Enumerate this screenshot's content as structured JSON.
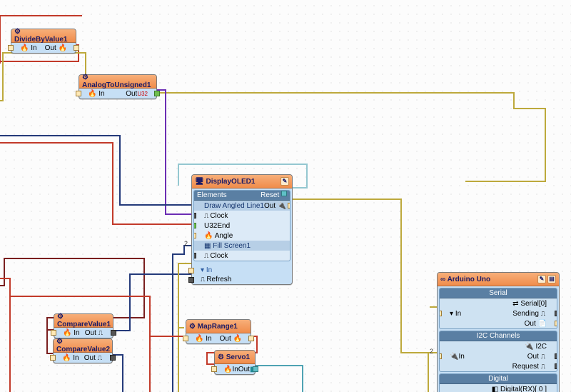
{
  "badges": {
    "two": "2"
  },
  "nodes": {
    "divide": {
      "title": "DivideByValue1",
      "in": "In",
      "out": "Out"
    },
    "atu": {
      "title": "AnalogToUnsigned1",
      "in": "In",
      "out": "Out",
      "out_type": "U32"
    },
    "oled": {
      "title": "DisplayOLED1",
      "sec_elements": "Elements",
      "reset": "Reset",
      "el_line": "Draw Angled Line1",
      "out": "Out",
      "clock": "Clock",
      "end": "End",
      "end_type": "U32",
      "angle": "Angle",
      "el_fill": "Fill Screen1",
      "in": "In",
      "refresh": "Refresh"
    },
    "cmp1": {
      "title": "CompareValue1",
      "in": "In",
      "out": "Out"
    },
    "cmp2": {
      "title": "CompareValue2",
      "in": "In",
      "out": "Out"
    },
    "map": {
      "title": "MapRange1",
      "in": "In",
      "out": "Out"
    },
    "servo": {
      "title": "Servo1",
      "in": "In",
      "out": "Out"
    },
    "ard": {
      "title": "Arduino Uno",
      "sec_serial": "Serial",
      "serial0": "Serial[0]",
      "in": "In",
      "sending": "Sending",
      "out": "Out",
      "sec_i2c": "I2C Channels",
      "i2c": "I2C",
      "request": "Request",
      "sec_digital": "Digital",
      "digital0": "Digital(RX)[ 0 ]"
    }
  },
  "wires": [
    {
      "from": "offscreen-left",
      "to": "DivideByValue1",
      "color": "red"
    },
    {
      "from": "DivideByValue1.Out",
      "to": "offscreen-left",
      "color": "red"
    },
    {
      "from": "offscreen-left",
      "to": "AnalogToUnsigned1.In",
      "color": "olive",
      "via": "top-right-loop"
    },
    {
      "from": "AnalogToUnsigned1.Out",
      "to": "DisplayOLED1.End",
      "color": "purple"
    },
    {
      "from": "offscreen-left",
      "to": "DisplayOLED1.DrawAngledLine1.Clock",
      "color": "navy"
    },
    {
      "from": "offscreen-left",
      "to": "DisplayOLED1.Angle",
      "color": "red"
    },
    {
      "from": "offscreen-left",
      "to": "CompareValue1.In",
      "color": "maroon"
    },
    {
      "from": "offscreen-left",
      "to": "CompareValue2.In",
      "color": "maroon"
    },
    {
      "from": "CompareValue1.Out",
      "to": "DisplayOLED1.Refresh",
      "color": "navy"
    },
    {
      "from": "CompareValue2.Out",
      "to": "offscreen-bottom",
      "color": "navy"
    },
    {
      "from": "DisplayOLED1.In",
      "to": "offscreen-bottom",
      "color": "olive"
    },
    {
      "from": "DisplayOLED1.FillScreen1.Clock",
      "to": "offscreen-bottom",
      "color": "navy"
    },
    {
      "from": "DisplayOLED1.Out",
      "to": "ArduinoUno.I2C.In",
      "color": "olive"
    },
    {
      "from": "MapRange1.In",
      "to": "offscreen-left",
      "color": "red"
    },
    {
      "from": "MapRange1.Out",
      "to": "Servo1.In",
      "color": "red"
    },
    {
      "from": "Servo1.Out",
      "to": "offscreen-bottom",
      "color": "teal"
    },
    {
      "from": "DisplayOLED1.Reset",
      "to": "loop",
      "color": "teal"
    }
  ],
  "colors": {
    "olive": "#bda93c",
    "red": "#c23a2a",
    "navy": "#243a7a",
    "teal": "#4fa3b3",
    "maroon": "#7a1f1f",
    "purple": "#6b2db3",
    "node_title_bg": "#f08c4b",
    "node_body_bg": "#c6dff5",
    "section_hdr_bg": "#5a7fa3"
  }
}
